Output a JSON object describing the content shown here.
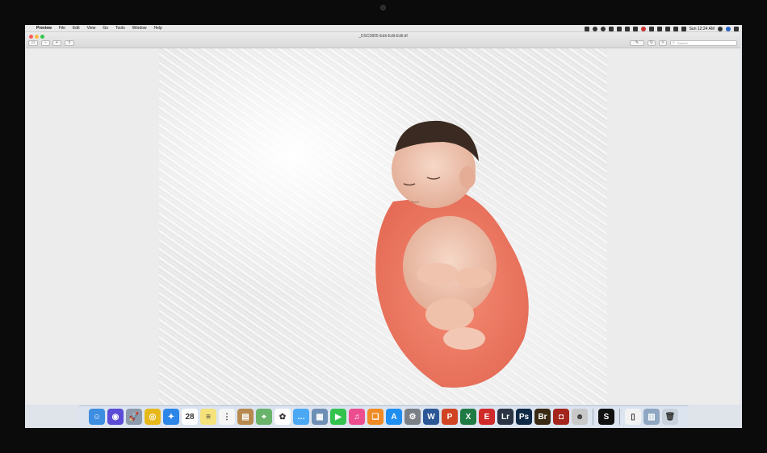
{
  "menubar": {
    "apple": "",
    "items": [
      "Preview",
      "File",
      "Edit",
      "View",
      "Go",
      "Tools",
      "Window",
      "Help"
    ],
    "clock": "Sun 12:24 AM"
  },
  "window": {
    "title": "_DSC0805-Edit-Edit-Edit.tif",
    "search_placeholder": "Search"
  },
  "dock": {
    "apps": [
      {
        "name": "Finder",
        "icon": "finder-icon",
        "color": "#3d8de0",
        "glyph": "☺"
      },
      {
        "name": "Siri",
        "icon": "siri-icon",
        "color": "#5b4bd6",
        "glyph": "◉"
      },
      {
        "name": "Launchpad",
        "icon": "launchpad-icon",
        "color": "#8c9aab",
        "glyph": "🚀"
      },
      {
        "name": "Chrome",
        "icon": "chrome-icon",
        "color": "#e7b81a",
        "glyph": "◎"
      },
      {
        "name": "Safari",
        "icon": "safari-icon",
        "color": "#2b86e8",
        "glyph": "✦"
      },
      {
        "name": "Calendar",
        "icon": "calendar-icon",
        "color": "#ffffff",
        "glyph": "28"
      },
      {
        "name": "Notes",
        "icon": "notes-icon",
        "color": "#f6e27a",
        "glyph": "≡"
      },
      {
        "name": "Reminders",
        "icon": "reminders-icon",
        "color": "#f5f5f5",
        "glyph": "⋮"
      },
      {
        "name": "Contacts",
        "icon": "contacts-icon",
        "color": "#b7894e",
        "glyph": "▤"
      },
      {
        "name": "Maps",
        "icon": "maps-icon",
        "color": "#69b46a",
        "glyph": "⌖"
      },
      {
        "name": "Photos",
        "icon": "photos-icon",
        "color": "#ffffff",
        "glyph": "✿"
      },
      {
        "name": "Messages",
        "icon": "messages-icon",
        "color": "#4aa8f5",
        "glyph": "…"
      },
      {
        "name": "Image Capture",
        "icon": "image-capture-icon",
        "color": "#6e8fb5",
        "glyph": "▦"
      },
      {
        "name": "FaceTime",
        "icon": "facetime-icon",
        "color": "#32c24d",
        "glyph": "▶"
      },
      {
        "name": "iTunes",
        "icon": "itunes-icon",
        "color": "#ec4d8f",
        "glyph": "♫"
      },
      {
        "name": "iBooks",
        "icon": "ibooks-icon",
        "color": "#f08a24",
        "glyph": "❑"
      },
      {
        "name": "App Store",
        "icon": "app-store-icon",
        "color": "#1f8ef1",
        "glyph": "A"
      },
      {
        "name": "System Preferences",
        "icon": "system-preferences-icon",
        "color": "#7b7f86",
        "glyph": "⚙"
      },
      {
        "name": "Word",
        "icon": "word-icon",
        "color": "#2b5797",
        "glyph": "W"
      },
      {
        "name": "PowerPoint",
        "icon": "powerpoint-icon",
        "color": "#d04423",
        "glyph": "P"
      },
      {
        "name": "Excel",
        "icon": "excel-icon",
        "color": "#1f7a43",
        "glyph": "X"
      },
      {
        "name": "Acrobat",
        "icon": "acrobat-icon",
        "color": "#d12a2a",
        "glyph": "E"
      },
      {
        "name": "Lightroom",
        "icon": "lightroom-icon",
        "color": "#2a3444",
        "glyph": "Lr"
      },
      {
        "name": "Photoshop",
        "icon": "photoshop-icon",
        "color": "#0e2a47",
        "glyph": "Ps"
      },
      {
        "name": "Bridge",
        "icon": "bridge-icon",
        "color": "#3a2a14",
        "glyph": "Br"
      },
      {
        "name": "Photo Booth",
        "icon": "photo-booth-icon",
        "color": "#a3251c",
        "glyph": "◘"
      },
      {
        "name": "Automator",
        "icon": "automator-icon",
        "color": "#c8c8c8",
        "glyph": "☻"
      }
    ],
    "extras": [
      {
        "name": "Screenflick",
        "icon": "screenflick-icon",
        "color": "#111111",
        "glyph": "S"
      }
    ],
    "trash_area": [
      {
        "name": "Document",
        "icon": "document-icon",
        "color": "#f2f2f2",
        "glyph": "▯"
      },
      {
        "name": "Preview",
        "icon": "preview-icon",
        "color": "#8fa7c2",
        "glyph": "▥"
      },
      {
        "name": "Trash",
        "icon": "trash-icon",
        "color": "#c9d2dc",
        "glyph": "🗑"
      }
    ]
  }
}
